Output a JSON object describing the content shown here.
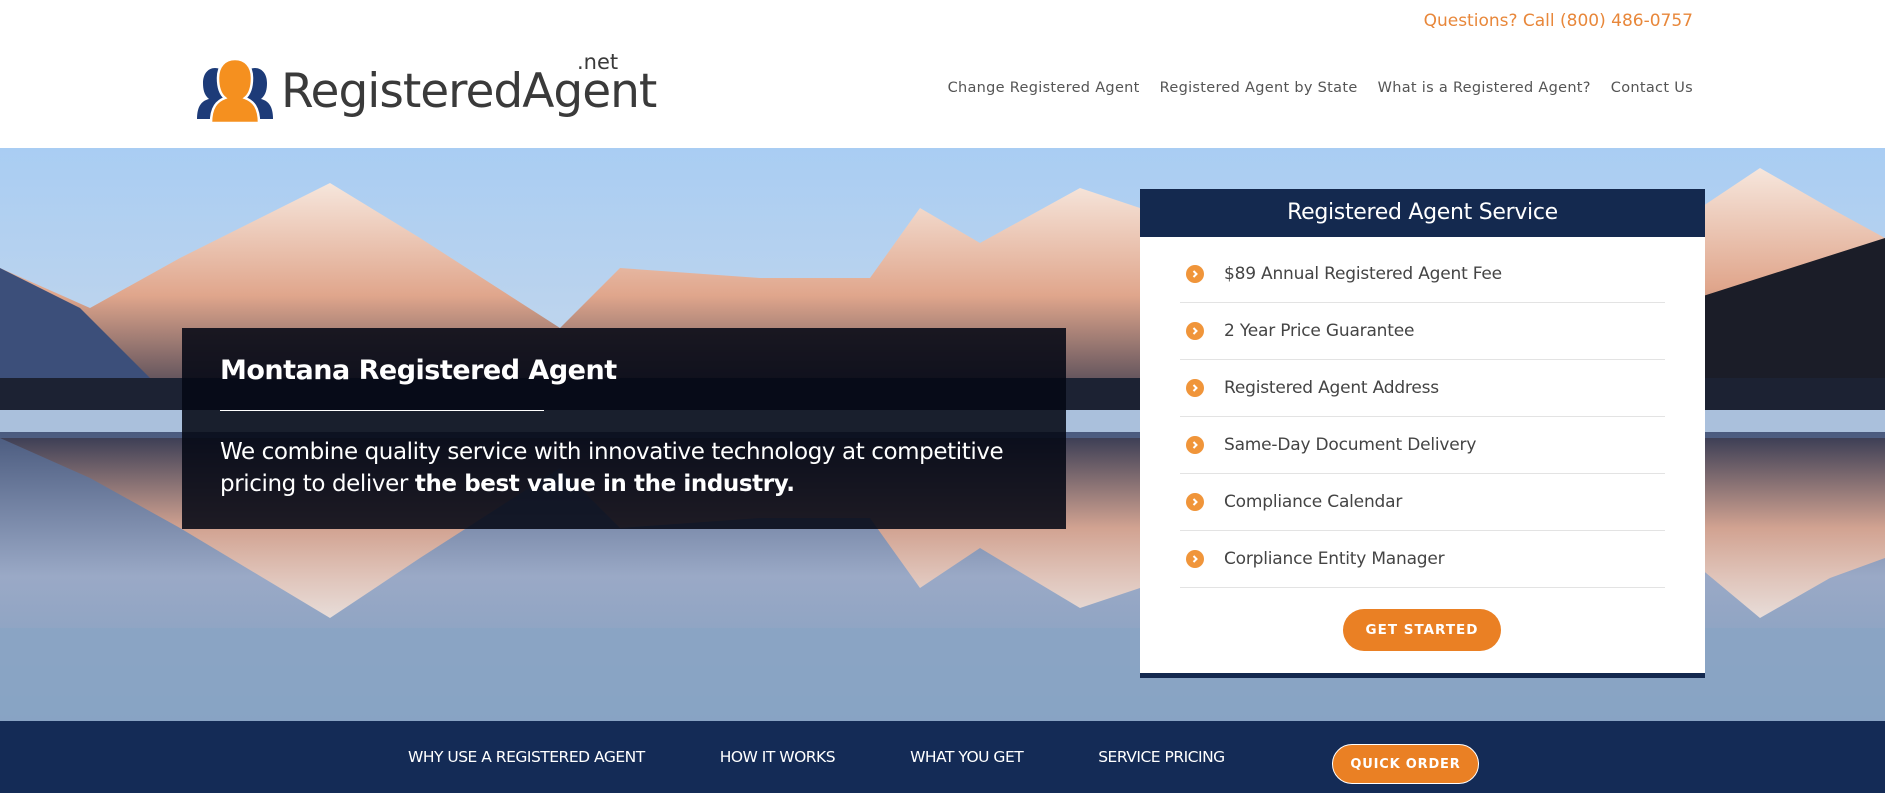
{
  "header": {
    "phone_text": "Questions? Call (800) 486-0757",
    "logo": {
      "name": "RegisteredAgent",
      "tld": ".net",
      "icon": "people-group-icon"
    },
    "nav": [
      {
        "label": "Change Registered Agent"
      },
      {
        "label": "Registered Agent by State"
      },
      {
        "label": "What is a Registered Agent?"
      },
      {
        "label": "Contact Us"
      }
    ]
  },
  "hero": {
    "background": "mountain-lake-reflection-photo",
    "title": "Montana Registered Agent",
    "text_regular": "We combine quality service with innovative technology at competitive pricing to deliver ",
    "text_bold": "the best value in the industry."
  },
  "service_card": {
    "title": "Registered Agent Service",
    "bullet_icon": "chevron-circle-right-icon",
    "items": [
      {
        "label": "$89 Annual Registered Agent Fee"
      },
      {
        "label": "2 Year Price Guarantee"
      },
      {
        "label": "Registered Agent Address"
      },
      {
        "label": "Same-Day Document Delivery"
      },
      {
        "label": "Compliance Calendar"
      },
      {
        "label": "Corpliance Entity Manager"
      }
    ],
    "cta_label": "GET STARTED"
  },
  "subnav": {
    "items": [
      {
        "label": "WHY USE A REGISTERED AGENT"
      },
      {
        "label": "HOW IT WORKS"
      },
      {
        "label": "WHAT YOU GET"
      },
      {
        "label": "SERVICE PRICING"
      }
    ],
    "quick_order_label": "QUICK ORDER"
  },
  "colors": {
    "accent_orange": "#ea8024",
    "navy": "#14294f",
    "phone_orange": "#e8873a"
  }
}
